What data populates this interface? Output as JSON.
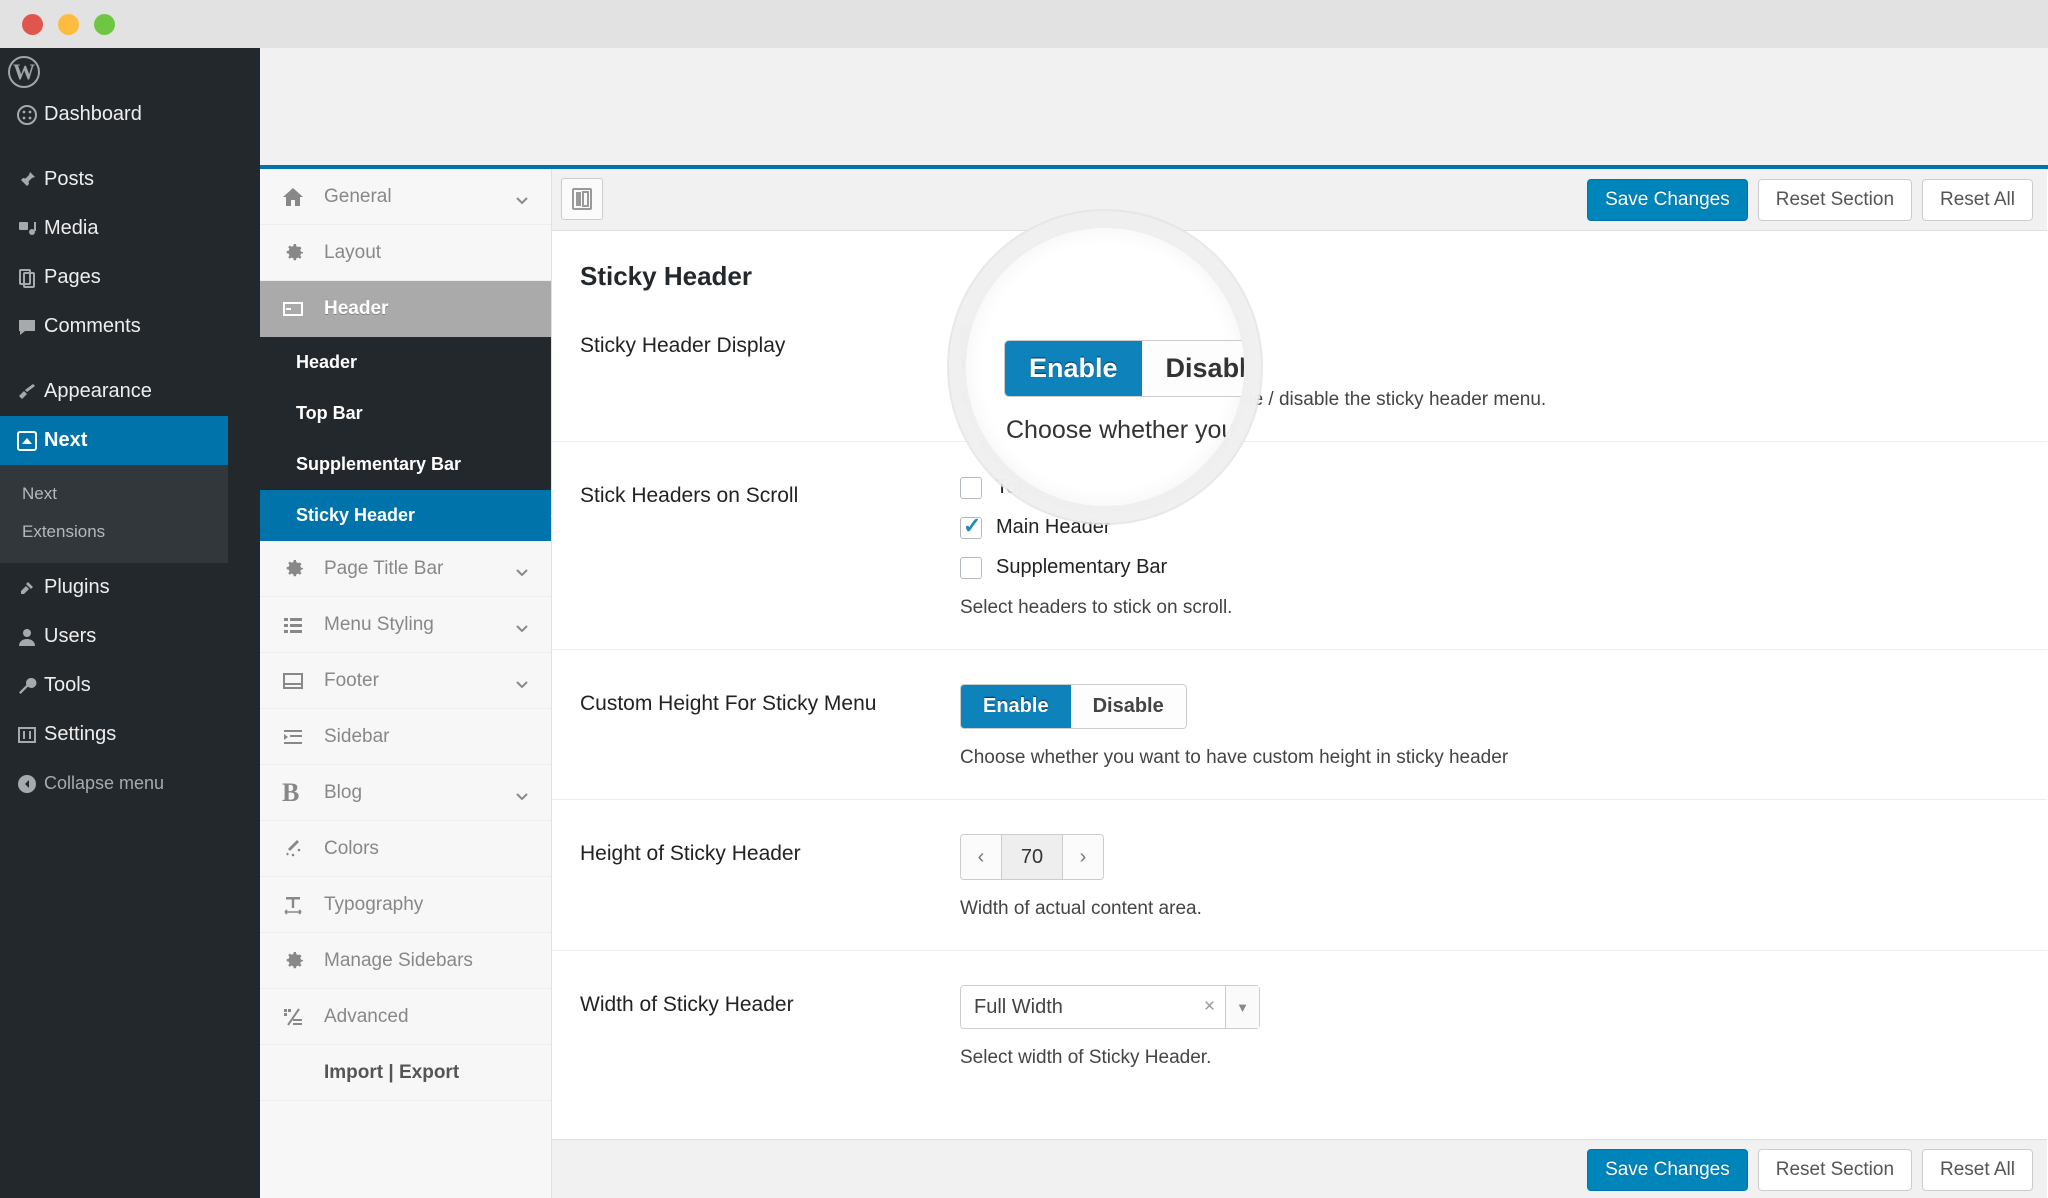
{
  "window": {
    "buttons": [
      "close",
      "minimize",
      "maximize"
    ]
  },
  "wp_sidebar": {
    "logo_glyph": "W",
    "items": [
      {
        "label": "Dashboard",
        "icon": "dashboard-icon"
      },
      {
        "label": "Posts",
        "icon": "pin-icon"
      },
      {
        "label": "Media",
        "icon": "media-icon"
      },
      {
        "label": "Pages",
        "icon": "pages-icon"
      },
      {
        "label": "Comments",
        "icon": "comment-icon"
      },
      {
        "label": "Appearance",
        "icon": "brush-icon"
      },
      {
        "label": "Next",
        "icon": "next-icon"
      },
      {
        "label": "Plugins",
        "icon": "plug-icon"
      },
      {
        "label": "Users",
        "icon": "user-icon"
      },
      {
        "label": "Tools",
        "icon": "wrench-icon"
      },
      {
        "label": "Settings",
        "icon": "settings-icon"
      }
    ],
    "submenu": [
      "Next",
      "Extensions"
    ],
    "collapse_label": "Collapse menu"
  },
  "options_nav": {
    "items": [
      {
        "label": "General",
        "icon": "home-icon",
        "chevron": true
      },
      {
        "label": "Layout",
        "icon": "gear-icon",
        "chevron": false
      },
      {
        "label": "Header",
        "icon": "header-icon",
        "chevron": false
      },
      {
        "label": "Page Title Bar",
        "icon": "gear-icon",
        "chevron": true
      },
      {
        "label": "Menu Styling",
        "icon": "list-icon",
        "chevron": true
      },
      {
        "label": "Footer",
        "icon": "footer-icon",
        "chevron": true
      },
      {
        "label": "Sidebar",
        "icon": "sidebar-icon",
        "chevron": false
      },
      {
        "label": "Blog",
        "icon": "bold-b-icon",
        "chevron": true
      },
      {
        "label": "Colors",
        "icon": "wand-icon",
        "chevron": false
      },
      {
        "label": "Typography",
        "icon": "type-icon",
        "chevron": false
      },
      {
        "label": "Manage Sidebars",
        "icon": "gear-icon",
        "chevron": false
      },
      {
        "label": "Advanced",
        "icon": "advanced-icon",
        "chevron": false
      }
    ],
    "header_subitems": [
      "Header",
      "Top Bar",
      "Supplementary Bar",
      "Sticky Header"
    ],
    "import_export": "Import | Export"
  },
  "toolbar": {
    "panel_toggle_icon": "layout-toggle-icon",
    "save_label": "Save Changes",
    "reset_section_label": "Reset Section",
    "reset_all_label": "Reset All"
  },
  "section": {
    "title": "Sticky Header",
    "fields": [
      {
        "label": "Sticky Header Display",
        "type": "switch",
        "on_label": "Enable",
        "off_label": "Disable",
        "value": "Enable",
        "desc": "Choose whether you want to enable / disable the sticky header menu."
      },
      {
        "label": "Stick Headers on Scroll",
        "type": "checkboxes",
        "options": [
          {
            "label": "Top Bar",
            "checked": false
          },
          {
            "label": "Main Header",
            "checked": true
          },
          {
            "label": "Supplementary Bar",
            "checked": false
          }
        ],
        "desc": "Select headers to stick on scroll."
      },
      {
        "label": "Custom Height For Sticky Menu",
        "type": "switch",
        "on_label": "Enable",
        "off_label": "Disable",
        "value": "Enable",
        "desc": "Choose whether you want to have custom height in sticky header"
      },
      {
        "label": "Height of Sticky Header",
        "type": "spinner",
        "value": "70",
        "dec": "‹",
        "inc": "›",
        "desc": "Width of actual content area."
      },
      {
        "label": "Width of Sticky Header",
        "type": "select",
        "value": "Full Width",
        "clear": "×",
        "arrow": "▼",
        "desc": "Select width of Sticky Header."
      }
    ]
  },
  "magnifier": {
    "on_label": "Enable",
    "off_label": "Disable",
    "desc": "Choose whether you w"
  },
  "colors": {
    "accent_blue": "#0073aa",
    "switch_blue": "#0e83bb",
    "wp_dark": "#23282d",
    "wp_submenu": "#32373c",
    "panel_gray": "#f1f1f1",
    "active_gray": "#aaaaaa"
  }
}
